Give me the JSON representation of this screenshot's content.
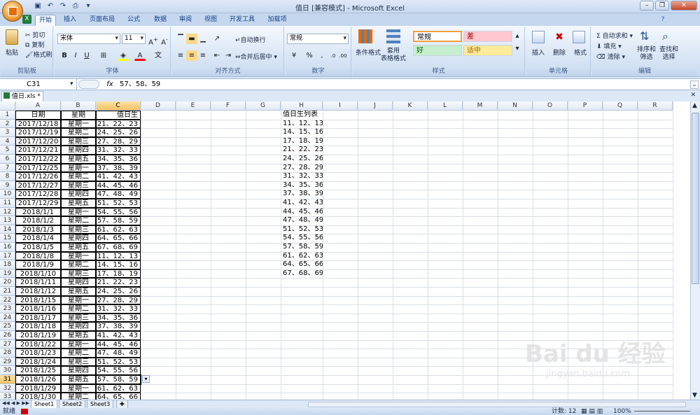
{
  "window": {
    "title": "值日 [兼容模式] - Microsoft Excel",
    "qat_icons": [
      "save-icon",
      "undo-icon",
      "redo-icon",
      "print-preview-icon"
    ]
  },
  "tabs": [
    "开始",
    "插入",
    "页面布局",
    "公式",
    "数据",
    "审阅",
    "视图",
    "开发工具",
    "加载项"
  ],
  "ribbon": {
    "clipboard": {
      "paste": "粘贴",
      "cut": "剪切",
      "copy": "复制",
      "format_painter": "格式刷",
      "label": "剪贴板"
    },
    "font": {
      "name": "宋体",
      "size": "11",
      "bold": "B",
      "italic": "I",
      "underline": "U",
      "label": "字体"
    },
    "alignment": {
      "wrap": "自动换行",
      "merge": "合并后居中",
      "label": "对齐方式"
    },
    "number": {
      "format": "常规",
      "percent": "%",
      "label": "数字"
    },
    "styles": {
      "conditional": "条件格式",
      "table_format": "套用\n表格格式",
      "normal": "常规",
      "bad": "差",
      "good": "好",
      "neutral": "适中",
      "label": "样式"
    },
    "cells": {
      "insert": "插入",
      "delete": "删除",
      "format": "格式",
      "label": "单元格"
    },
    "editing": {
      "autosum": "自动求和",
      "fill": "填充",
      "clear": "清除",
      "sort": "排序和\n筛选",
      "find": "查找和\n选择",
      "label": "编辑"
    },
    "colors": {
      "bad_bg": "#ffc7ce",
      "good_bg": "#c6efce",
      "neutral_bg": "#ffeb9c",
      "normal_border": "#f2a13a"
    }
  },
  "formula_bar": {
    "name_box": "C31",
    "fx": "fx",
    "formula": "57、58、59"
  },
  "workbook_tab": "值日.xls *",
  "columns": [
    "A",
    "B",
    "C",
    "D",
    "E",
    "F",
    "G",
    "H",
    "I",
    "J",
    "K",
    "L",
    "M",
    "N",
    "O",
    "P",
    "Q",
    "R"
  ],
  "selected_cell": {
    "col": "C",
    "row": 31
  },
  "rows": [
    {
      "r": "1",
      "a": "日期",
      "b": "星期",
      "c": "值日生",
      "h": "值日生列表"
    },
    {
      "r": "2",
      "a": "2017/12/18",
      "b": "星期一",
      "c": "21、22、23",
      "h": "11、12、13"
    },
    {
      "r": "3",
      "a": "2017/12/19",
      "b": "星期二",
      "c": "24、25、26",
      "h": "14、15、16"
    },
    {
      "r": "4",
      "a": "2017/12/20",
      "b": "星期三",
      "c": "27、28、29",
      "h": "17、18、19"
    },
    {
      "r": "5",
      "a": "2017/12/21",
      "b": "星期四",
      "c": "31、32、33",
      "h": "21、22、23"
    },
    {
      "r": "6",
      "a": "2017/12/22",
      "b": "星期五",
      "c": "34、35、36",
      "h": "24、25、26"
    },
    {
      "r": "7",
      "a": "2017/12/25",
      "b": "星期一",
      "c": "37、38、39",
      "h": "27、28、29"
    },
    {
      "r": "8",
      "a": "2017/12/26",
      "b": "星期二",
      "c": "41、42、43",
      "h": "31、32、33"
    },
    {
      "r": "9",
      "a": "2017/12/27",
      "b": "星期三",
      "c": "44、45、46",
      "h": "34、35、36"
    },
    {
      "r": "10",
      "a": "2017/12/28",
      "b": "星期四",
      "c": "47、48、49",
      "h": "37、38、39"
    },
    {
      "r": "11",
      "a": "2017/12/29",
      "b": "星期五",
      "c": "51、52、53",
      "h": "41、42、43"
    },
    {
      "r": "12",
      "a": "2018/1/1",
      "b": "星期一",
      "c": "54、55、56",
      "h": "44、45、46"
    },
    {
      "r": "13",
      "a": "2018/1/2",
      "b": "星期二",
      "c": "57、58、59",
      "h": "47、48、49"
    },
    {
      "r": "14",
      "a": "2018/1/3",
      "b": "星期三",
      "c": "61、62、63",
      "h": "51、52、53"
    },
    {
      "r": "15",
      "a": "2018/1/4",
      "b": "星期四",
      "c": "64、65、66",
      "h": "54、55、56"
    },
    {
      "r": "16",
      "a": "2018/1/5",
      "b": "星期五",
      "c": "67、68、69",
      "h": "57、58、59"
    },
    {
      "r": "17",
      "a": "2018/1/8",
      "b": "星期一",
      "c": "11、12、13",
      "h": "61、62、63"
    },
    {
      "r": "18",
      "a": "2018/1/9",
      "b": "星期二",
      "c": "14、15、16",
      "h": "64、65、66"
    },
    {
      "r": "19",
      "a": "2018/1/10",
      "b": "星期三",
      "c": "17、18、19",
      "h": "67、68、69"
    },
    {
      "r": "20",
      "a": "2018/1/11",
      "b": "星期四",
      "c": "21、22、23",
      "h": ""
    },
    {
      "r": "21",
      "a": "2018/1/12",
      "b": "星期五",
      "c": "24、25、26",
      "h": ""
    },
    {
      "r": "22",
      "a": "2018/1/15",
      "b": "星期一",
      "c": "27、28、29",
      "h": ""
    },
    {
      "r": "23",
      "a": "2018/1/16",
      "b": "星期二",
      "c": "31、32、33",
      "h": ""
    },
    {
      "r": "24",
      "a": "2018/1/17",
      "b": "星期三",
      "c": "34、35、36",
      "h": ""
    },
    {
      "r": "25",
      "a": "2018/1/18",
      "b": "星期四",
      "c": "37、38、39",
      "h": ""
    },
    {
      "r": "26",
      "a": "2018/1/19",
      "b": "星期五",
      "c": "41、42、43",
      "h": ""
    },
    {
      "r": "27",
      "a": "2018/1/22",
      "b": "星期一",
      "c": "44、45、46",
      "h": ""
    },
    {
      "r": "28",
      "a": "2018/1/23",
      "b": "星期二",
      "c": "47、48、49",
      "h": ""
    },
    {
      "r": "29",
      "a": "2018/1/24",
      "b": "星期三",
      "c": "51、52、53",
      "h": ""
    },
    {
      "r": "30",
      "a": "2018/1/25",
      "b": "星期四",
      "c": "54、55、56",
      "h": ""
    },
    {
      "r": "31",
      "a": "2018/1/26",
      "b": "星期五",
      "c": "57、58、59",
      "h": ""
    },
    {
      "r": "32",
      "a": "2018/1/29",
      "b": "星期一",
      "c": "61、62、63",
      "h": ""
    },
    {
      "r": "33",
      "a": "2018/1/30",
      "b": "星期二",
      "c": "64、65、66",
      "h": ""
    }
  ],
  "sheet_tabs": [
    "Sheet1",
    "Sheet2",
    "Sheet3"
  ],
  "status": {
    "ready": "就绪",
    "count": "计数: 12",
    "zoom": "100%"
  },
  "watermark": {
    "line1": "Bai du 经验",
    "line2": "jingyan.baidu.com"
  }
}
